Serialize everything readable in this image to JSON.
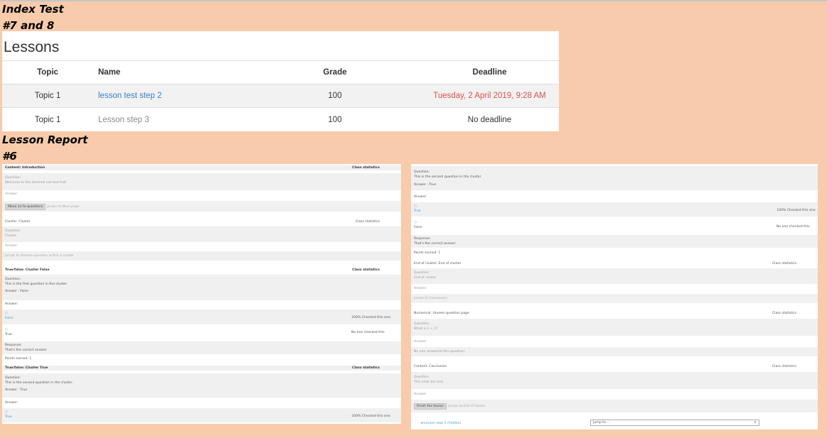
{
  "index_heading": "Index Test",
  "index_sub": "#7 and 8",
  "lessons": {
    "title": "Lessons",
    "columns": [
      "Topic",
      "Name",
      "Grade",
      "Deadline"
    ],
    "rows": [
      {
        "topic": "Topic 1",
        "name": "lesson test step 2",
        "grade": "100",
        "deadline": "Tuesday, 2 April 2019, 9:28 AM"
      },
      {
        "topic": "Topic 1",
        "name": "Lesson step 3",
        "grade": "100",
        "deadline": "No deadline"
      }
    ]
  },
  "report_heading": "Lesson Report",
  "report_sub": "#6",
  "left_panel": {
    "content_intro": "Content: Introduction",
    "class_statistics": "Class statistics",
    "question_label": "Question:",
    "intro_question": "Welcome to the dimmed out test test.",
    "answer_label": "Answer:",
    "move_on_button": "Move on to questions",
    "jumps_next": "Jumps to Next page",
    "cluster_title": "Cluster: Cluster",
    "cluster_question": "Cluster",
    "jumps_unseen": "Jumps to Unseen question within a cluster",
    "tf_false_title": "True/false: Cluster False",
    "tf_false_question": "This is the first question in the cluster.",
    "answer_false": "Answer : False",
    "false_opt": "False",
    "false_stat": "100% Checked this one.",
    "true_opt": "True",
    "true_stat": "No one checked this.",
    "response_label": "Response:",
    "response_text": "That's the correct answer",
    "points": "Points earned: 1",
    "tf_true_title": "True/false: Cluster True",
    "tf_true_question": "This is the second question in the cluster.",
    "answer_true": "Answer : True",
    "true_stat2": "100% Checked this one."
  },
  "right_panel": {
    "question_label": "Question:",
    "second_question": "This is the second question in the cluster.",
    "answer_true": "Answer : True",
    "answer_label": "Answer:",
    "true_opt": "True",
    "true_stat": "100% Checked this one.",
    "false_opt": "False",
    "false_stat": "No one checked this.",
    "response_label": "Response:",
    "response_text": "That's the correct answer",
    "points": "Points earned: 1",
    "eoc_title": "End of cluster: End of cluster",
    "class_statistics": "Class statistics",
    "eoc_question": "End of cluster",
    "jumps_conclusion": "Jumps to Conclusion",
    "numerical_title": "Numerical: Unseen question page",
    "numerical_question": "What is 1 + 1?",
    "no_answer": "No one answered this question.",
    "conclusion_title": "Content: Conclusion",
    "conclusion_question": "This ends the test.",
    "finish_button": "Finish the lesson",
    "jumps_end": "Jumps to End of lesson",
    "prev_link": "◄ Lesson step 3 (hidden)",
    "jump_select": "Jump to..."
  }
}
